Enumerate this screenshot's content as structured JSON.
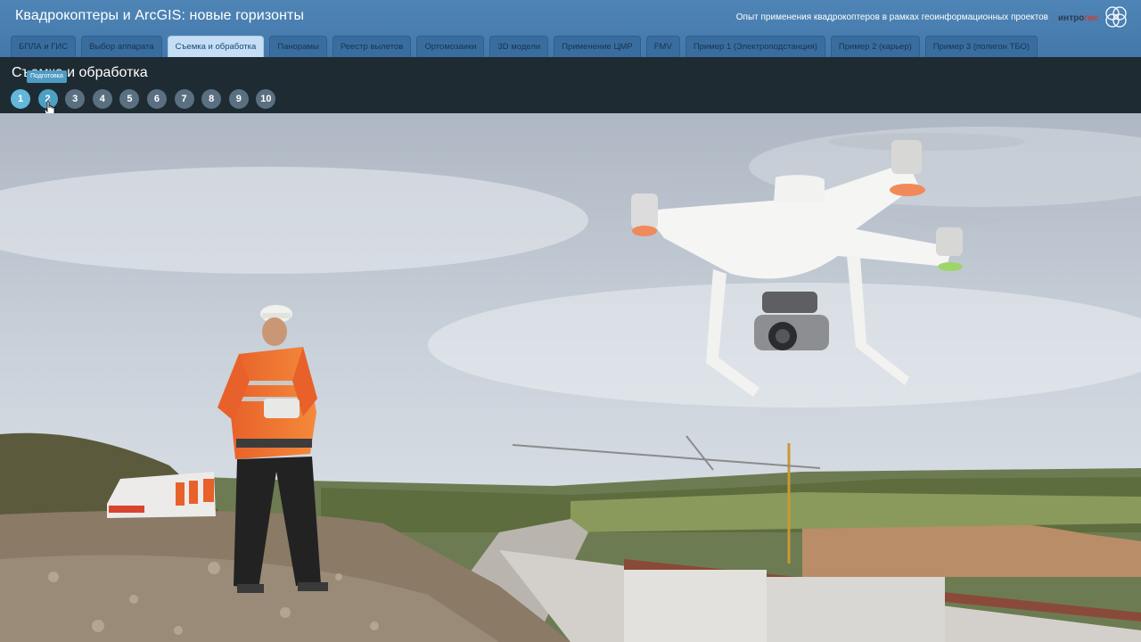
{
  "header": {
    "title": "Квадрокоптеры и ArcGIS: новые горизонты",
    "subtitle": "Опыт применения квадрокоптеров в рамках геоинформационных проектов",
    "logo": {
      "text_main": "интро",
      "text_accent": "гис",
      "brand_color": "#d23a2e"
    }
  },
  "tabs": [
    {
      "label": "БПЛА и ГИС"
    },
    {
      "label": "Выбор аппарата"
    },
    {
      "label": "Съемка и обработка",
      "active": true
    },
    {
      "label": "Панорамы"
    },
    {
      "label": "Реестр вылетов"
    },
    {
      "label": "Ортомозаики"
    },
    {
      "label": "3D модели"
    },
    {
      "label": "Применение ЦМР"
    },
    {
      "label": "FMV"
    },
    {
      "label": "Пример 1 (Электроподстанция)"
    },
    {
      "label": "Пример 2 (карьер)"
    },
    {
      "label": "Пример 3 (полигон ТБО)"
    }
  ],
  "section": {
    "title": "Съемка и обработка",
    "tooltip": "Подготовка",
    "current_step": "1",
    "hovered_step": "2",
    "steps": [
      "1",
      "2",
      "3",
      "4",
      "5",
      "6",
      "7",
      "8",
      "9",
      "10"
    ]
  },
  "slide": {
    "image": "photo-drone-operator-construction-site"
  },
  "colors": {
    "header_bg": "#4a7fb1",
    "tab_active_bg": "#c6def5",
    "subbar_bg": "#1f2b33",
    "step_active": "#63b7d9",
    "step_default": "#5a7081"
  }
}
